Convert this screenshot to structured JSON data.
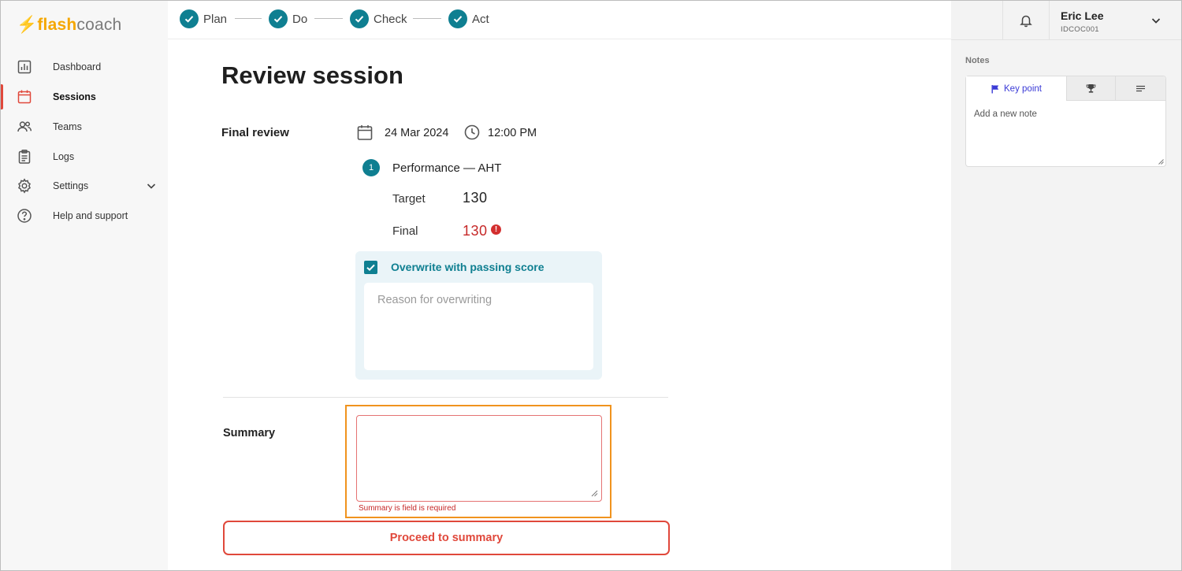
{
  "brand": {
    "bolt": "⚡",
    "flash": "flash",
    "coach": "coach"
  },
  "sidebar": {
    "items": [
      {
        "label": "Dashboard",
        "icon": "bar-chart-icon"
      },
      {
        "label": "Sessions",
        "icon": "calendar-icon",
        "active": true
      },
      {
        "label": "Teams",
        "icon": "people-icon"
      },
      {
        "label": "Logs",
        "icon": "clipboard-icon"
      },
      {
        "label": "Settings",
        "icon": "gear-icon",
        "expandable": true
      },
      {
        "label": "Help and support",
        "icon": "help-circle-icon"
      }
    ]
  },
  "stepper": {
    "steps": [
      {
        "label": "Plan",
        "done": true
      },
      {
        "label": "Do",
        "done": true
      },
      {
        "label": "Check",
        "done": true
      },
      {
        "label": "Act",
        "done": true
      }
    ]
  },
  "main": {
    "title": "Review session",
    "final_review": {
      "label": "Final review",
      "date": "24 Mar 2024",
      "time": "12:00 PM"
    },
    "metric": {
      "index": "1",
      "name": "Performance — AHT",
      "target_label": "Target",
      "target_value": "130",
      "final_label": "Final",
      "final_value": "130",
      "final_alert": "!"
    },
    "overwrite": {
      "checked": true,
      "label": "Overwrite with passing score",
      "reason_placeholder": "Reason for overwriting",
      "reason_value": ""
    },
    "summary": {
      "label": "Summary",
      "value": "",
      "error": "Summary is field is required"
    },
    "proceed_button": "Proceed to summary"
  },
  "user": {
    "name": "Eric Lee",
    "id": "IDCOC001"
  },
  "notes": {
    "heading": "Notes",
    "tabs": [
      {
        "label": "Key point",
        "icon": "flag-icon",
        "active": true
      },
      {
        "label": "",
        "icon": "trophy-icon"
      },
      {
        "label": "",
        "icon": "lines-icon"
      }
    ],
    "placeholder": "Add a new note"
  },
  "colors": {
    "accent_teal": "#0f7f91",
    "danger_red": "#e0483b",
    "error_red": "#c62828",
    "brand_orange": "#f5a700",
    "highlight_orange": "#f0931e",
    "keypoint_blue": "#3a3ad6"
  }
}
